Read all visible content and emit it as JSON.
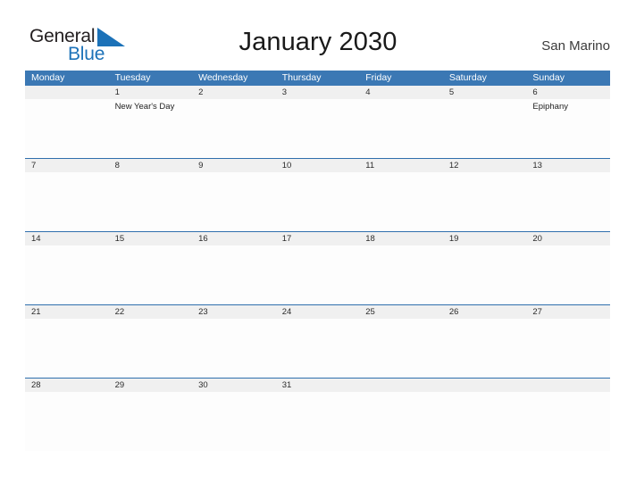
{
  "brand": {
    "name_part1": "General",
    "name_part2": "Blue",
    "flag_icon": "blue-triangle-flag-icon",
    "accent_color": "#1c72b8"
  },
  "header": {
    "title": "January 2030",
    "region": "San Marino"
  },
  "theme": {
    "header_bar_color": "#3b78b4",
    "row_divider_color": "#2f6fad",
    "day_strip_color": "#f0f0f0",
    "cell_background": "#fdfdfd",
    "text_color": "#222222"
  },
  "calendar": {
    "weekdays": [
      "Monday",
      "Tuesday",
      "Wednesday",
      "Thursday",
      "Friday",
      "Saturday",
      "Sunday"
    ],
    "weeks": [
      [
        {
          "day": "",
          "event": ""
        },
        {
          "day": "1",
          "event": "New Year's Day"
        },
        {
          "day": "2",
          "event": ""
        },
        {
          "day": "3",
          "event": ""
        },
        {
          "day": "4",
          "event": ""
        },
        {
          "day": "5",
          "event": ""
        },
        {
          "day": "6",
          "event": "Epiphany"
        }
      ],
      [
        {
          "day": "7",
          "event": ""
        },
        {
          "day": "8",
          "event": ""
        },
        {
          "day": "9",
          "event": ""
        },
        {
          "day": "10",
          "event": ""
        },
        {
          "day": "11",
          "event": ""
        },
        {
          "day": "12",
          "event": ""
        },
        {
          "day": "13",
          "event": ""
        }
      ],
      [
        {
          "day": "14",
          "event": ""
        },
        {
          "day": "15",
          "event": ""
        },
        {
          "day": "16",
          "event": ""
        },
        {
          "day": "17",
          "event": ""
        },
        {
          "day": "18",
          "event": ""
        },
        {
          "day": "19",
          "event": ""
        },
        {
          "day": "20",
          "event": ""
        }
      ],
      [
        {
          "day": "21",
          "event": ""
        },
        {
          "day": "22",
          "event": ""
        },
        {
          "day": "23",
          "event": ""
        },
        {
          "day": "24",
          "event": ""
        },
        {
          "day": "25",
          "event": ""
        },
        {
          "day": "26",
          "event": ""
        },
        {
          "day": "27",
          "event": ""
        }
      ],
      [
        {
          "day": "28",
          "event": ""
        },
        {
          "day": "29",
          "event": ""
        },
        {
          "day": "30",
          "event": ""
        },
        {
          "day": "31",
          "event": ""
        },
        {
          "day": "",
          "event": ""
        },
        {
          "day": "",
          "event": ""
        },
        {
          "day": "",
          "event": ""
        }
      ]
    ]
  }
}
